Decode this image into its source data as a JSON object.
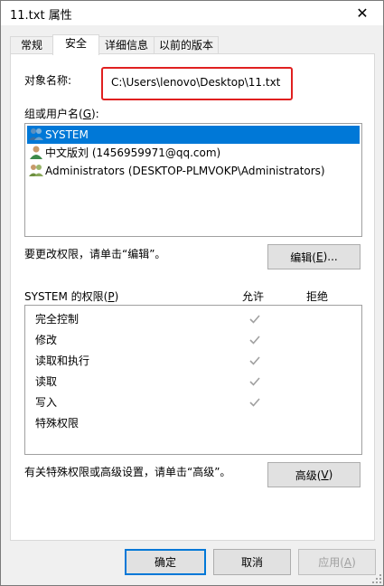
{
  "window": {
    "title": "11.txt 属性",
    "close_glyph": "✕"
  },
  "tabs": [
    {
      "label": "常规",
      "active": false
    },
    {
      "label": "安全",
      "active": true
    },
    {
      "label": "详细信息",
      "active": false
    },
    {
      "label": "以前的版本",
      "active": false
    }
  ],
  "security": {
    "object_name_label": "对象名称:",
    "object_path": "C:\\Users\\lenovo\\Desktop\\11.txt",
    "groups_label": "组或用户名(G):",
    "users": [
      {
        "name": "SYSTEM",
        "selected": true,
        "icon": "user-group-icon"
      },
      {
        "name": "中文版刘 (1456959971@qq.com)",
        "selected": false,
        "icon": "user-icon"
      },
      {
        "name": "Administrators (DESKTOP-PLMVOKP\\Administrators)",
        "selected": false,
        "icon": "user-group-icon"
      }
    ],
    "change_perm_text": "要更改权限，请单击“编辑”。",
    "edit_button": "编辑(E)...",
    "perm_for_label": "SYSTEM 的权限(P)",
    "allow_header": "允许",
    "deny_header": "拒绝",
    "permissions": [
      {
        "name": "完全控制",
        "allow": true,
        "deny": false
      },
      {
        "name": "修改",
        "allow": true,
        "deny": false
      },
      {
        "name": "读取和执行",
        "allow": true,
        "deny": false
      },
      {
        "name": "读取",
        "allow": true,
        "deny": false
      },
      {
        "name": "写入",
        "allow": true,
        "deny": false
      },
      {
        "name": "特殊权限",
        "allow": false,
        "deny": false
      }
    ],
    "advanced_text": "有关特殊权限或高级设置，请单击“高级”。",
    "advanced_button": "高级(V)"
  },
  "footer": {
    "ok": "确定",
    "cancel": "取消",
    "apply": "应用(A)"
  },
  "colors": {
    "selection": "#0078d7",
    "highlight_box": "#e02020",
    "check": "#a0a0a0"
  }
}
